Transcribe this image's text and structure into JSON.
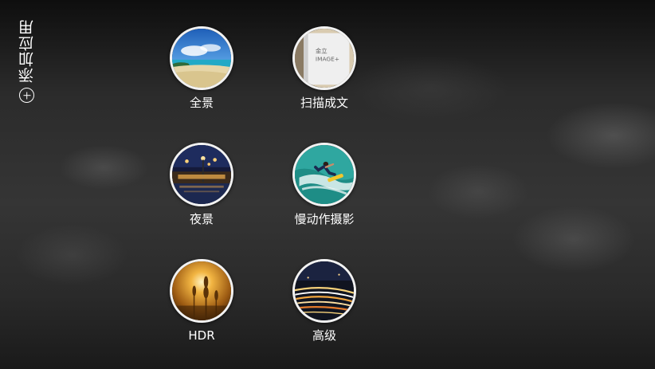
{
  "sidebar": {
    "add_app_label": "添加应用",
    "add_icon": "plus-circle-icon"
  },
  "modes": [
    {
      "label": "全景",
      "icon": "panorama-thumbnail"
    },
    {
      "label": "扫描成文",
      "icon": "document-scan-thumbnail",
      "thumb_text_line1": "金立",
      "thumb_text_line2": "IMAGE+"
    },
    {
      "label": "夜景",
      "icon": "night-scene-thumbnail"
    },
    {
      "label": "慢动作摄影",
      "icon": "slow-motion-thumbnail"
    },
    {
      "label": "HDR",
      "icon": "hdr-thumbnail"
    },
    {
      "label": "高级",
      "icon": "advanced-thumbnail"
    }
  ]
}
